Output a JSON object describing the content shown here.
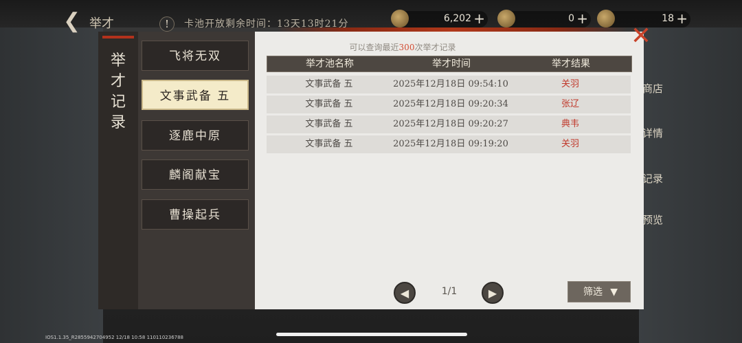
{
  "topbar": {
    "title": "举才",
    "timer": "卡池开放剩余时间：13天13时21分",
    "resources": [
      {
        "value": "6,202",
        "plus": "+"
      },
      {
        "value": "0",
        "plus": "+"
      },
      {
        "value": "18",
        "plus": "+"
      }
    ]
  },
  "side_menu": [
    "商店",
    "详情",
    "记录",
    "预览"
  ],
  "dialog": {
    "vertical_title": "举才记录",
    "tabs": [
      "飞将无双",
      "文事武备 五",
      "逐鹿中原",
      "麟阁献宝",
      "曹操起兵"
    ],
    "active_tab": 1,
    "hint_prefix": "可以查询最近",
    "hint_number": "300",
    "hint_suffix": "次举才记录",
    "columns": [
      "举才池名称",
      "举才时间",
      "举才结果"
    ],
    "rows": [
      {
        "pool": "文事武备 五",
        "time": "2025年12月18日 09:54:10",
        "result": "关羽"
      },
      {
        "pool": "文事武备 五",
        "time": "2025年12月18日 09:20:34",
        "result": "张辽"
      },
      {
        "pool": "文事武备 五",
        "time": "2025年12月18日 09:20:27",
        "result": "典韦"
      },
      {
        "pool": "文事武备 五",
        "time": "2025年12月18日 09:19:20",
        "result": "关羽"
      }
    ],
    "page": "1/1",
    "filter_label": "筛选"
  },
  "debug_text": "IOS1.1.35_R2855942704952 12/18 10:58 110110236788"
}
